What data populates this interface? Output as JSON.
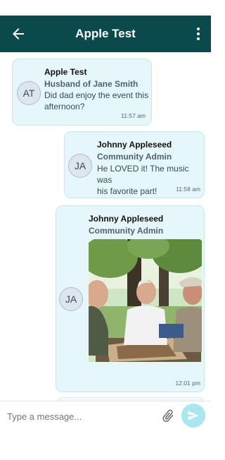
{
  "header": {
    "title": "Apple Test",
    "back_icon": "arrow-left-icon",
    "menu_icon": "more-vertical-icon",
    "background": "#0b4a4c"
  },
  "messages": [
    {
      "initials": "AT",
      "name": "Apple Test",
      "role": "Husband of Jane Smith",
      "text_line1": "Did dad enjoy the event this",
      "text_line2": "afternoon?",
      "time": "11:57 am"
    },
    {
      "initials": "JA",
      "name": "Johnny Appleseed",
      "role": "Community Admin",
      "text_line1": "He LOVED it! The music was",
      "text_line2": "his favorite part!",
      "time": "11:58 am"
    },
    {
      "initials": "JA",
      "name": "Johnny Appleseed",
      "role": "Community Admin",
      "image": "photo of elderly men playing chess in a park",
      "time": "12:01 pm"
    }
  ],
  "composer": {
    "placeholder": "Type a message...",
    "attach_icon": "paperclip-icon",
    "send_icon": "send-icon",
    "send_color": "#a9e6ee"
  },
  "colors": {
    "bubble": "#e6f7fb",
    "bubble_border": "#c7e6ee"
  }
}
